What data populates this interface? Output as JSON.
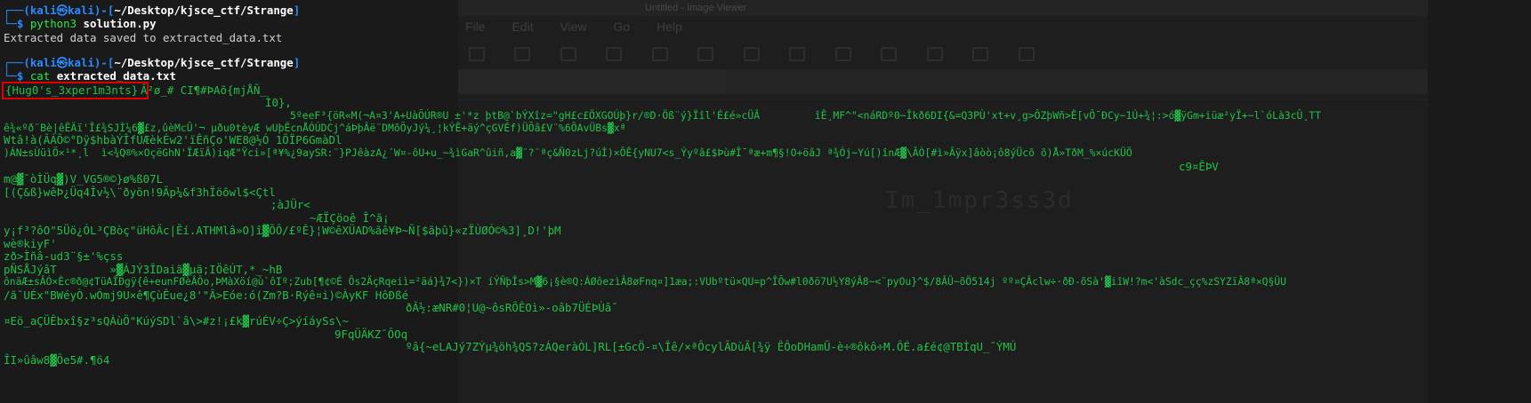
{
  "background_window": {
    "title": "Untitled - Image Viewer",
    "menu": [
      "File",
      "Edit",
      "View",
      "Go",
      "Help"
    ],
    "watermark": "Im_1mpr3ss3d"
  },
  "prompt1": {
    "head": "┌──(",
    "user": "kali㉿kali",
    "mid": ")-[",
    "dir": "~/Desktop/kjsce_ctf/Strange",
    "tail": "]",
    "cmd_prefix": "└─$ ",
    "cmd": "python3",
    "cmd_arg": "solution.py"
  },
  "output1": "Extracted data saved to extracted_data.txt",
  "prompt2": {
    "head": "┌──(",
    "user": "kali㉿kali",
    "mid": ")-[",
    "dir": "~/Desktop/kjsce_ctf/Strange",
    "tail": "]",
    "cmd_prefix": "└─$ ",
    "cmd": "cat",
    "cmd_arg": "extracted_data.txt"
  },
  "flag": "{Hug0's_3xper1m3nts}",
  "data_lines": [
    "Â²ø_# CI¶#ÞAõ{mjÅÑ_",
    "Ì0},",
    "5ºeeF³{öR«M(¬A¤3'A+UàÕÚR®U ±'*z þtB@`bÝXîz=\"gH£c£ÖXGOÚþ}r/®D·Öß¨ý}Ïîl'É£é»cÜÂ         îÊ¸MF^\"<náRDº0~Îkð6DI{&=Q3PÙ'xt+v¸g>ÔZþWñ>Ê[vÔ¯ÐCy~1Ú+¾¦:>ó▓ÿGm+iüæ²yÏ+~l`óLà3cÛ¸TT",
    "ê¾«ºð¨Bè|êËÄï'Î£¾SJÌ¼6▓£z,ûèMcÛ'¬ µðu0tèyÆ wUþÊcnÅÓÚDCj^áÞþÂë¨DMõÕyJý¼¸¦kÝÊ+äý^çGVÉf)ÜÕâ£V¨%6ÔAvÜBs▓xª",
    "Wtâ!à(ÂÁÕ©°Dÿ$hbàÝÎfÚÆèkÉw2'ïÊñÇo'WE8@½Ó 1ÕÏP6GmàDl",
    ")ÁN±sÙüìÖ×¹*¸l  ì<¾Q®%×OçëGhN'ÏÆïÂ)iqÆ\"Ÿci»[ª¥%¿9aySR:¨}PJêàzA¿´W¤-ôU+u_~¾ìGaR^ûiñ,a▓¨?¨ªç&Ñ0zLj?úÌ)×ÔÊ{yNU7<s_Ýyºâ£$Þù#Î¯ªæ+m¶§!O+öâJ ª¾Ój~Yú[)înÆ▓\\ÂÒ[#ì»Âÿx]âòò¡ô8ýÜcõ õ)Å»TðM_%×úcKÜÖ",
    "c9¤ÊÞV",
    "m@▓¯òÌÜq▓)V_VG5®©}ø%ß07L",
    "[(Ç&ß}wêÞ¿Üq4Îv½\\¨ðyön!9Äp¼&f3hÏöõwl$<Çtl",
    ";àJÜr<",
    "~ÆÏÇöoê Î^ã¡",
    "y¡f³?ôO\"5Üö¿ÓL³ÇBòç\"üHôÄc|Ëí.ATHMlâ»O]î▓ÕÔ/£ºÊ}¦W©êXÜAD%ãê¥Þ~Ñ[$ãþû}«zÏÙØÓ©%3]¸D!'þM",
    "wè®kiyF'",
    "zð>Ìñâ-ud3¨§±'%çss",
    "pÑSÅJýâT        »▓ÁJÝ3ÎDaiã▓µä;IÖêÚT,*_~hB",
    "ônäÆ±sÂÓ×Èc®ð@¢TüAÎÐgÿ{ê+eunFØèÂÔo,ÞMàXöí@ù`ôIº;Zub[¶¢©É Ôs2ÄçRqeiì=²äá}¾7<})×T íÝÑþÎs>M▓6¡§è®Q:ÁØôezìÂ8øFnq¤]1æa;:VUbºtü×QU=p^ÎÕw#l0ðö7U½Y8ýÂ8~<¨pyOu}^$/8ÂÜ~õÖ514j ºº¤ÇÂclw÷·ðÐ-õSà'▓iîW!?m<'àSdc_çç%zSYZïÂ8ª×Q§ÜU",
    "/ã¯UÉx\"BWéyÒ.wÓmj9U×ê¶ÇùÊue¿8'\"Â>Eóe:ó(Zm?B·Rýê¤i)©ÀyKF HôÐßé",
    "ðÂ½:æNR#0¦U@~ôsRÕÊOì»-oâb7ÜÉÞÙâ¯",
    "¤Eö_aÇÜÊbxî§z³sQÀùÖ\"KúýSDl`â\\>#z!¡£k▓rúÉV÷Ç>ýíáySs\\~",
    "9FqÜÄKZ¯ÔOq",
    "ºâ{~eLAJý7ZÝµ¾öh¾QS?zÁQeràÒL]RL[±GcÖ-¤\\Îê/×ªÔcylÃDùÃ[¾ÿ ÊÔoDHamÜ-è÷®ôkô÷M.ÔÉ.a£é¢@TBÌqU_¯ÝMÚ",
    "ÎI»ûâw8▓Ôe5#.¶ö4"
  ]
}
